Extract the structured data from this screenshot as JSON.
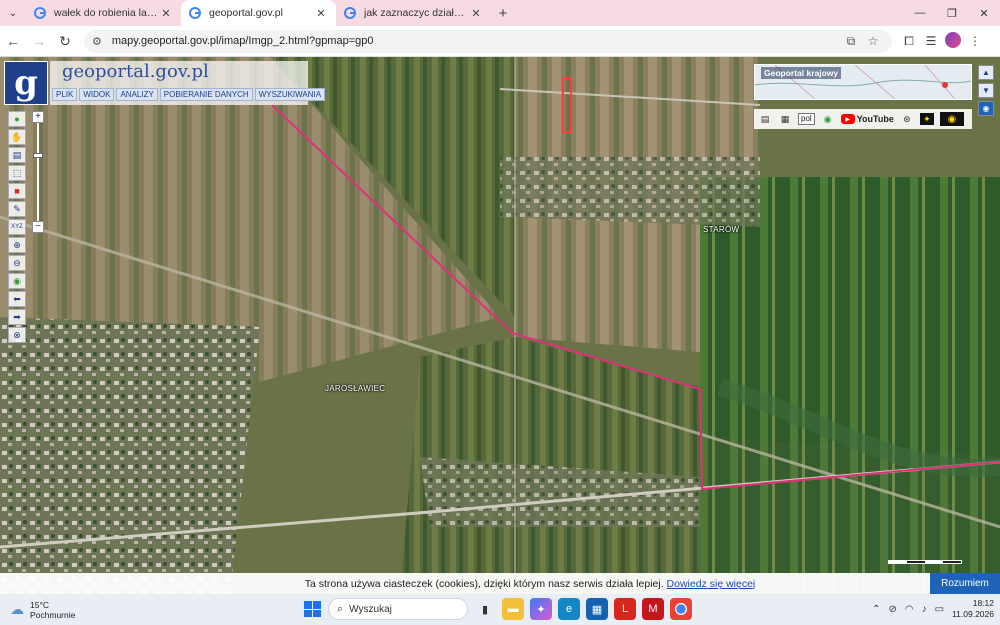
{
  "browser": {
    "tabs": [
      {
        "title": "wałek do robienia lamperii - Sz…",
        "active": false,
        "favicon": "google-icon"
      },
      {
        "title": "geoportal.gov.pl",
        "active": true,
        "favicon": "geoportal-icon"
      },
      {
        "title": "jak zaznaczyc działke na geopo…",
        "active": false,
        "favicon": "google-icon"
      }
    ],
    "url": "mapy.geoportal.gov.pl/imap/Imgp_2.html?gpmap=gp0",
    "accent": "#f6dbe2"
  },
  "geoportal": {
    "logo_letter": "g",
    "brand": "geoportal.gov.pl",
    "menu": [
      "PLIK",
      "WIDOK",
      "ANALIZY",
      "POBIERANIE DANYCH",
      "WYSZUKIWANIA"
    ],
    "overview_label": "Geoportal krajowy",
    "language": "pol",
    "youtube_label": "YouTube",
    "place_labels": [
      "STARÓW",
      "JAROSŁAWIEC"
    ],
    "brand_color": "#1e3f8a"
  },
  "cookie": {
    "text": "Ta strona używa ciasteczek (cookies), dzięki którym nasz serwis działa lepiej.",
    "link": "Dowiedz się więcej",
    "button": "Rozumiem"
  },
  "taskbar": {
    "weather_temp": "15°C",
    "weather_desc": "Pochmurnie",
    "search_placeholder": "Wyszukaj",
    "time": "18:12",
    "date": "11.09.2026"
  }
}
